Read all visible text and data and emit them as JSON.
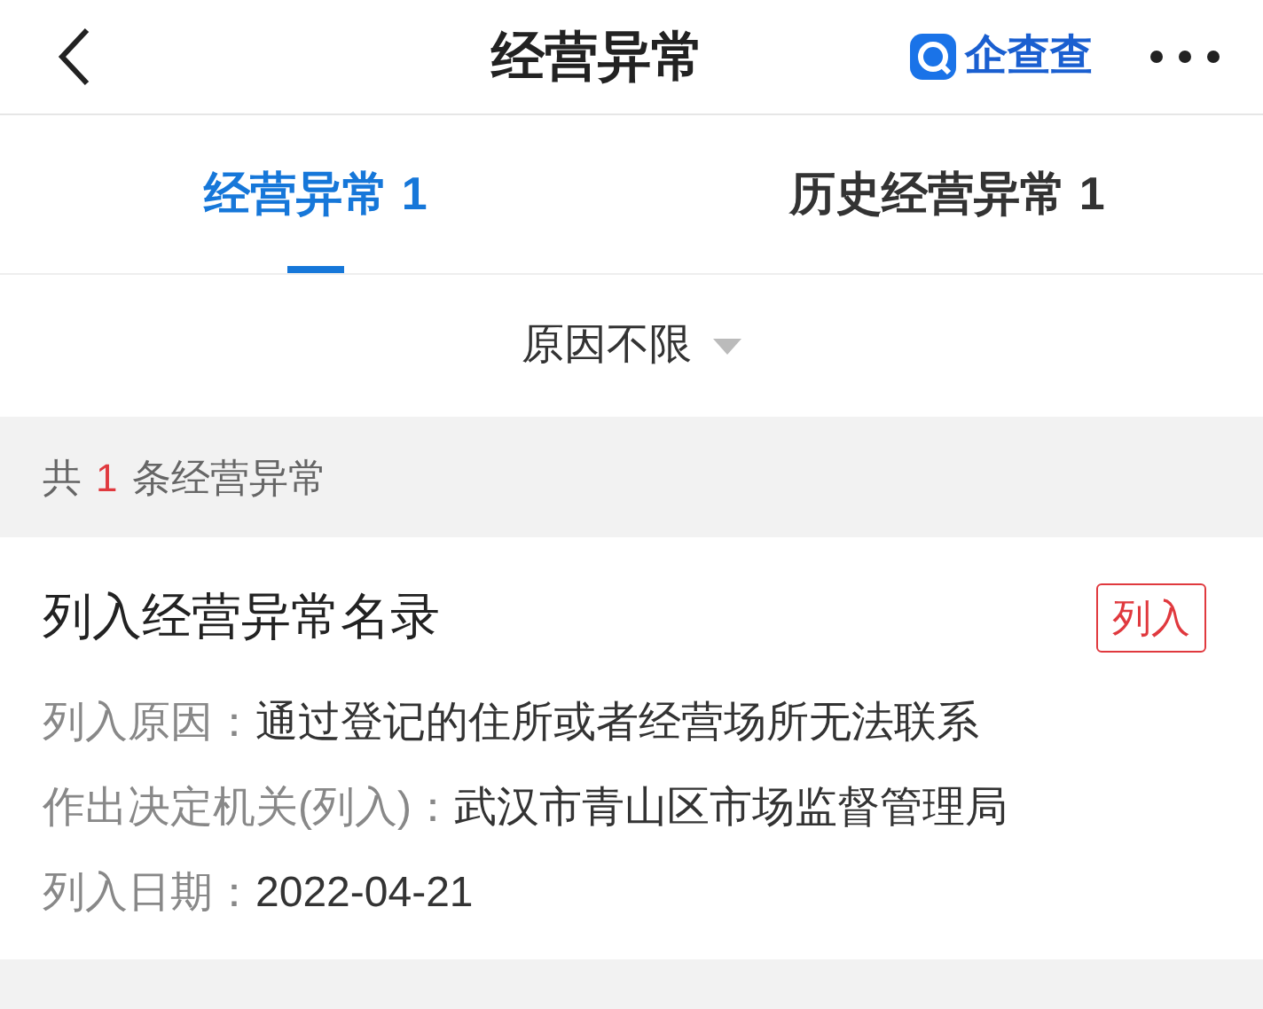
{
  "header": {
    "title": "经营异常",
    "brand": "企查查"
  },
  "tabs": [
    {
      "label": "经营异常 1",
      "selected": true
    },
    {
      "label": "历史经营异常 1",
      "selected": false
    }
  ],
  "filter": {
    "label": "原因不限"
  },
  "summary": {
    "prefix": "共",
    "count": "1",
    "suffix": "条经营异常"
  },
  "records": [
    {
      "title": "列入经营异常名录",
      "badge": "列入",
      "fields": [
        {
          "label": "列入原因：",
          "value": "通过登记的住所或者经营场所无法联系"
        },
        {
          "label": "作出决定机关(列入)：",
          "value": "武汉市青山区市场监督管理局"
        },
        {
          "label": "列入日期：",
          "value": "2022-04-21"
        }
      ]
    }
  ]
}
